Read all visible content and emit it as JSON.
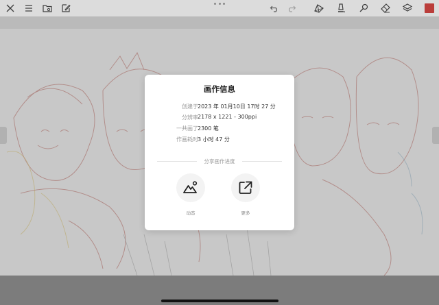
{
  "toolbar": {
    "left_icons": [
      "close-icon",
      "menu-icon",
      "folder-icon",
      "edit-icon"
    ],
    "right_icons": [
      "undo-icon",
      "redo-icon",
      "transform-icon",
      "brush-icon",
      "smudge-icon",
      "eraser-icon",
      "layers-icon"
    ],
    "color_swatch": "#c9302c"
  },
  "dialog": {
    "title": "画作信息",
    "rows": [
      {
        "label": "创建于",
        "value": "2023 年 01月10日 17时 27 分"
      },
      {
        "label": "分辨率",
        "value": "2178 x 1221 - 300ppi"
      },
      {
        "label": "一共画了",
        "value": "2300 笔"
      },
      {
        "label": "作画耗时",
        "value": "3 小时 47 分"
      }
    ],
    "share_section": "分享画作进度",
    "share_buttons": [
      {
        "label": "动态",
        "icon": "mountain-photo-icon"
      },
      {
        "label": "更多",
        "icon": "external-share-icon"
      }
    ]
  }
}
